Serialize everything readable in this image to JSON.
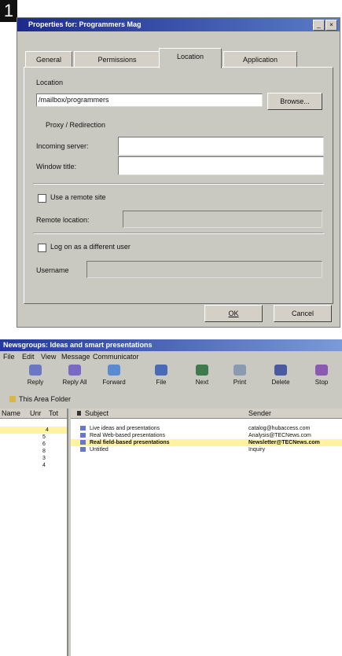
{
  "step_number": "1",
  "dialog": {
    "title": "Properties for: Programmers Mag",
    "tabs": [
      "General",
      "Permissions",
      "Location",
      "Application"
    ],
    "active_tab": "Location",
    "location_label": "Location",
    "location_value": "/mailbox/programmers",
    "browse_button": "Browse...",
    "group_label": "Proxy / Redirection",
    "remote_address_label": "Incoming server:",
    "window_label": "Window title:",
    "checkbox_remote": "Use a remote site",
    "remote_location_label": "Remote location:",
    "checkbox_user": "Log on as a different user",
    "username_label": "Username",
    "ok_button": "OK",
    "cancel_button": "Cancel"
  },
  "app": {
    "title": "Newsgroups: Ideas and smart presentations",
    "menus": [
      "File",
      "Edit",
      "View",
      "Message",
      "Communicator"
    ],
    "toolbar": [
      "Reply",
      "Reply All",
      "Forward",
      "File",
      "Next",
      "Print",
      "Delete",
      "Stop"
    ],
    "subbar_label": "This Area Folder",
    "left_columns": [
      "Name",
      "Unr",
      "Tot"
    ],
    "left_rows": [
      {
        "count": "4",
        "selected": true
      },
      {
        "count": "5",
        "selected": false
      },
      {
        "count": "6",
        "selected": false
      },
      {
        "count": "8",
        "selected": false
      },
      {
        "count": "3",
        "selected": false
      },
      {
        "count": "4",
        "selected": false
      }
    ],
    "right_columns": [
      "Subject",
      "Sender"
    ],
    "messages": [
      {
        "subject": "Live ideas and presentations",
        "sender": "catalog@hubaccess.com",
        "selected": false
      },
      {
        "subject": "Real Web-based presentations",
        "sender": "Analysis@TECNews.com",
        "selected": false
      },
      {
        "subject": "Real field-based presentations",
        "sender": "Newsletter@TECNews.com",
        "selected": true
      },
      {
        "subject": "Untitled",
        "sender": "Inquiry",
        "selected": false
      }
    ]
  },
  "colors": {
    "dialog_bg": "#c9c9c1",
    "titlebar": "#1c2a8c",
    "selection": "#fff3a0"
  }
}
